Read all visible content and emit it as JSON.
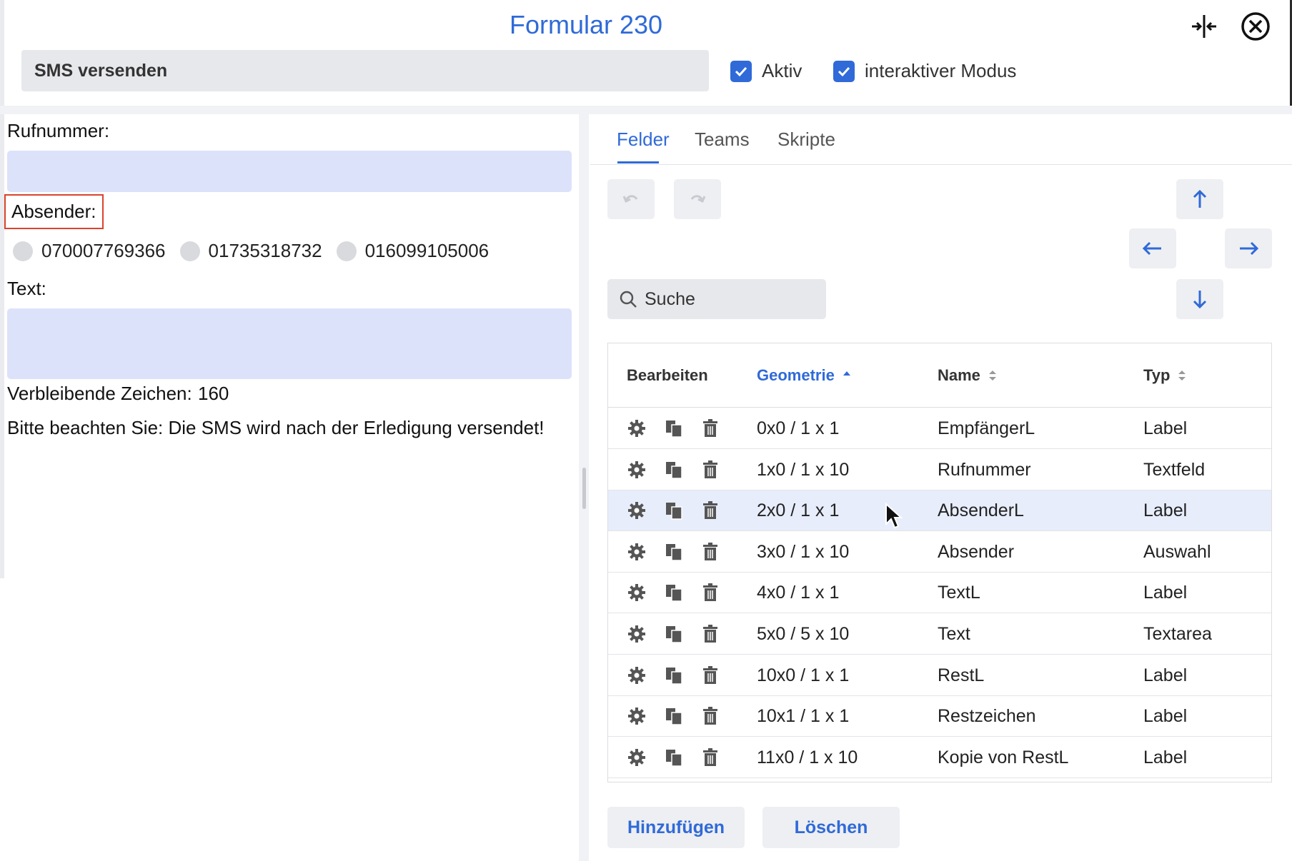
{
  "header": {
    "title": "Formular 230",
    "name_value": "SMS versenden",
    "checkbox_active_label": "Aktiv",
    "checkbox_interactive_label": "interaktiver Modus"
  },
  "form_preview": {
    "phone_label": "Rufnummer:",
    "sender_label": "Absender:",
    "sender_options": [
      "070007769366",
      "01735318732",
      "016099105006"
    ],
    "text_label": "Text:",
    "remaining_label": "Verbleibende Zeichen:",
    "remaining_value": "160",
    "notice": "Bitte beachten Sie: Die SMS wird nach der Erledigung versendet!"
  },
  "tabs": [
    "Felder",
    "Teams",
    "Skripte"
  ],
  "search": {
    "placeholder": "Suche"
  },
  "table": {
    "columns": {
      "edit": "Bearbeiten",
      "geometry": "Geometrie",
      "name": "Name",
      "type": "Typ"
    },
    "rows": [
      {
        "geometry": "0x0 / 1 x 1",
        "name": "EmpfängerL",
        "type": "Label"
      },
      {
        "geometry": "1x0 / 1 x 10",
        "name": "Rufnummer",
        "type": "Textfeld"
      },
      {
        "geometry": "2x0 / 1 x 1",
        "name": "AbsenderL",
        "type": "Label"
      },
      {
        "geometry": "3x0 / 1 x 10",
        "name": "Absender",
        "type": "Auswahl"
      },
      {
        "geometry": "4x0 / 1 x 1",
        "name": "TextL",
        "type": "Label"
      },
      {
        "geometry": "5x0 / 5 x 10",
        "name": "Text",
        "type": "Textarea"
      },
      {
        "geometry": "10x0 / 1 x 1",
        "name": "RestL",
        "type": "Label"
      },
      {
        "geometry": "10x1 / 1 x 1",
        "name": "Restzeichen",
        "type": "Label"
      },
      {
        "geometry": "11x0 / 1 x 10",
        "name": "Kopie von RestL",
        "type": "Label"
      }
    ]
  },
  "footer": {
    "add_label": "Hinzufügen",
    "delete_label": "Löschen"
  },
  "colors": {
    "accent": "#2f6ad8",
    "field_bg": "#dde2fb",
    "highlight_row": "#e7edfb",
    "boxed_border": "#d9442c"
  }
}
